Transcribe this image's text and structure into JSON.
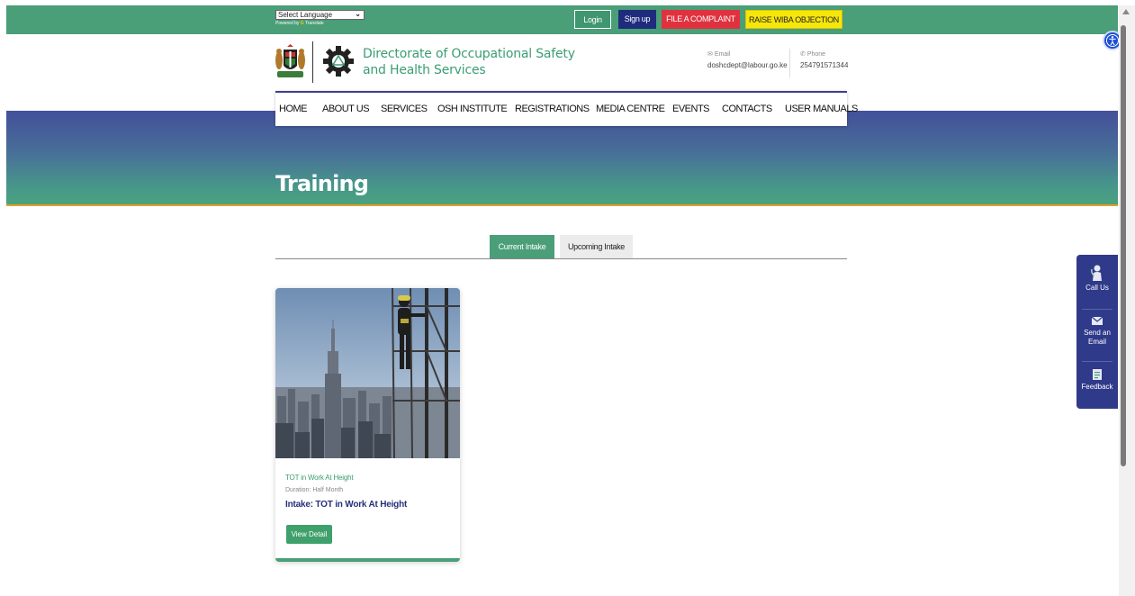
{
  "topbar": {
    "language_select": "Select Language",
    "powered_by": "Powered by",
    "powered_service": "Translate",
    "login": "Login",
    "signup": "Sign up",
    "file_complaint": "FILE A COMPLAINT",
    "raise_wiba": "RAISE WIBA OBJECTION"
  },
  "header": {
    "org_line1": "Directorate of Occupational Safety",
    "org_line2": "and Health Services",
    "email_label": "Email",
    "email_value": "doshcdept@labour.go.ke",
    "phone_label": "Phone",
    "phone_value": "254791571344"
  },
  "nav": [
    "HOME",
    "ABOUT US",
    "SERVICES",
    "OSH INSTITUTE",
    "REGISTRATIONS",
    "MEDIA CENTRE",
    "EVENTS",
    "CONTACTS",
    "USER MANUALS"
  ],
  "hero": {
    "title": "Training"
  },
  "tabs": {
    "current": "Current Intake",
    "upcoming": "Upcoming Intake"
  },
  "card": {
    "title": "TOT in Work At Height",
    "duration": "Duration: Half Month",
    "intake": "Intake: TOT in Work At Height",
    "button": "View Detail"
  },
  "widget": {
    "call": "Call Us",
    "email_line1": "Send an",
    "email_line2": "Email",
    "feedback": "Feedback"
  },
  "colors": {
    "brand_green": "#4a9e78",
    "navy": "#1f2c7d",
    "complaint_red": "#e0323e",
    "wiba_yellow": "#f6e60a",
    "accent_gold": "#e2a12b"
  }
}
